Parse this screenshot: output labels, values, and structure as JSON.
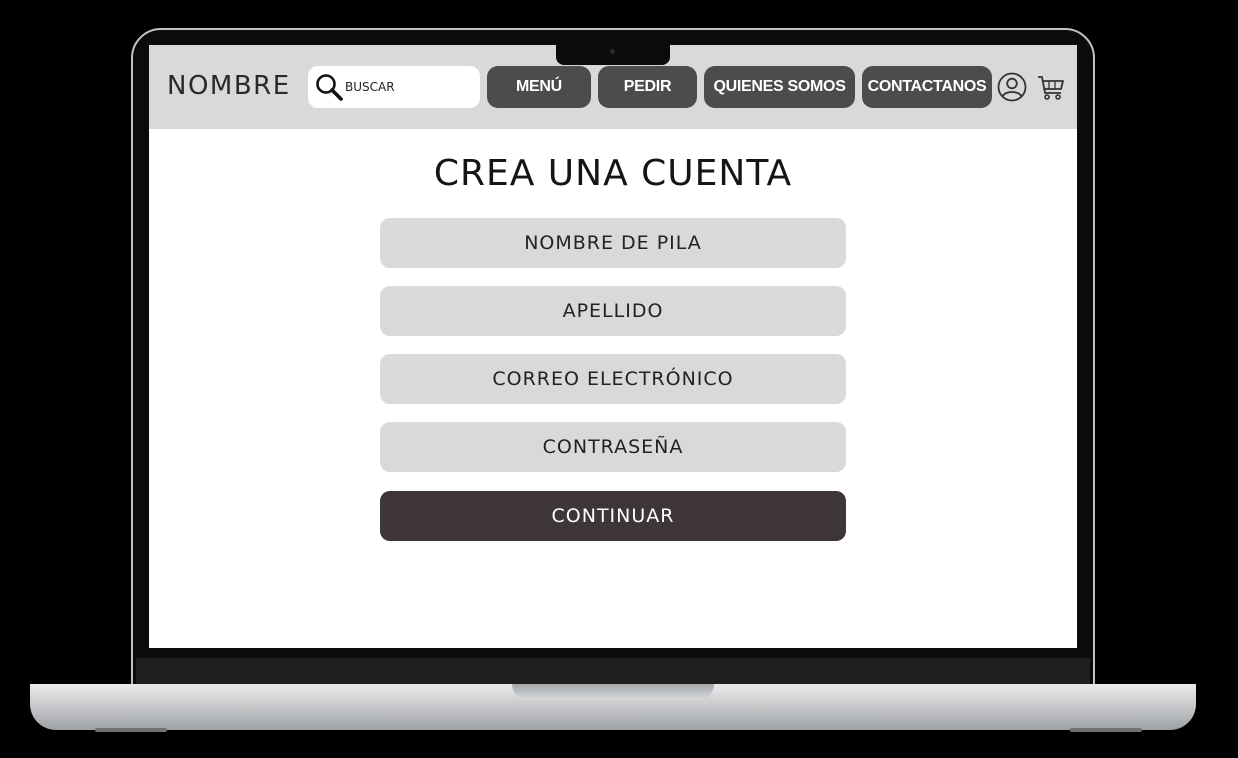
{
  "header": {
    "brand": "NOMBRE",
    "search_placeholder": "BUSCAR",
    "nav": {
      "menu": "MENÚ",
      "order": "PEDIR",
      "about": "QUIENES SOMOS",
      "contact": "CONTACTANOS"
    },
    "icons": {
      "search": "search-icon",
      "account": "user-icon",
      "cart": "cart-icon"
    }
  },
  "form": {
    "title": "CREA UNA CUENTA",
    "fields": {
      "first_name": "NOMBRE DE PILA",
      "last_name": "APELLIDO",
      "email": "CORREO ELECTRÓNICO",
      "password": "CONTRASEÑA"
    },
    "submit_label": "CONTINUAR"
  },
  "colors": {
    "navbar_bg": "#d9d9d9",
    "nav_button": "#4d4b4b",
    "field_bg": "#d9d9d9",
    "primary_button": "#3e3636"
  }
}
